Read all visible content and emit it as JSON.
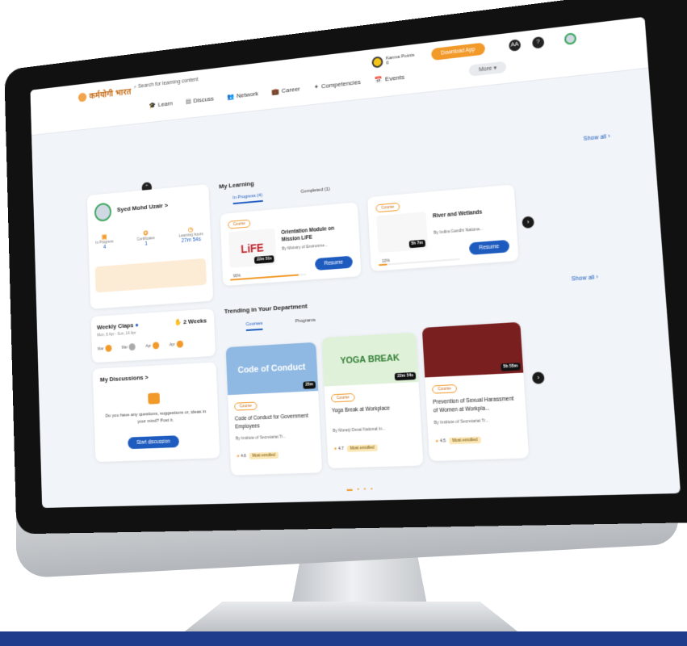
{
  "header": {
    "logo": "कर्मयोगी भारत",
    "search_placeholder": "Search for learning content",
    "nav": [
      "Learn",
      "Discuss",
      "Network",
      "Career",
      "Competencies",
      "Events"
    ],
    "more": "More",
    "karma_label": "Karma Points",
    "karma_value": "0",
    "download_app": "Download App",
    "icon_aa": "AA",
    "icon_help": "?"
  },
  "profile": {
    "name": "Syed Mohd Uzair",
    "arrow": ">",
    "stats": [
      {
        "label": "In Progress",
        "value": "4"
      },
      {
        "label": "Certificates",
        "value": "1"
      },
      {
        "label": "Learning hours",
        "value": "27m 54s"
      }
    ]
  },
  "weekly_claps": {
    "title": "Weekly Claps",
    "subtitle": "Mon, 8 Apr - Sun, 14 Apr",
    "weeks": "2 Weeks",
    "days": [
      "Mar",
      "Mar",
      "Apr",
      "Apr"
    ]
  },
  "discussions": {
    "title": "My Discussions",
    "arrow": ">",
    "text": "Do you have any questions, suggestions or, ideas in your mind? Post it.",
    "button": "Start discussion"
  },
  "my_learning": {
    "title": "My Learning",
    "show_all": "Show all",
    "tabs": [
      "In Progress (4)",
      "Completed (1)"
    ],
    "cards": [
      {
        "badge": "Course",
        "thumb": "LiFE",
        "duration": "22m 51s",
        "title": "Orientation Module on Mission LiFE",
        "by": "By Ministry of Environme...",
        "progress_label": "90%",
        "progress": 0.9,
        "button": "Resume"
      },
      {
        "badge": "Course",
        "thumb": "",
        "duration": "5h 7m",
        "title": "River and Wetlands",
        "by": "By Indira Gandhi Nationa...",
        "progress_label": "10%",
        "progress": 0.1,
        "button": "Resume"
      }
    ]
  },
  "trending": {
    "title": "Trending in Your Department",
    "show_all": "Show all",
    "tabs": [
      "Courses",
      "Programs"
    ],
    "cards": [
      {
        "badge": "Course",
        "image_text": "Code of Conduct",
        "duration": "25m",
        "title": "Code of Conduct for Government Employees",
        "by": "By Institute of Secretariat Tr...",
        "rating": "4.6",
        "tag": "Most enrolled"
      },
      {
        "badge": "Course",
        "image_text": "YOGA BREAK",
        "duration": "22m 54s",
        "title": "Yoga Break at Workplace",
        "by": "By Morarji Desai National In...",
        "rating": "4.7",
        "tag": "Most enrolled"
      },
      {
        "badge": "Course",
        "image_text": "",
        "duration": "5h 55m",
        "title": "Prevention of Sexual Harassment of Women at Workpla...",
        "by": "By Institute of Secretariat Tr...",
        "rating": "4.5",
        "tag": "Most enrolled"
      }
    ]
  },
  "colors": {
    "accent": "#f19a2a",
    "primary": "#1d5bbf",
    "band": "#1f3b8c"
  }
}
